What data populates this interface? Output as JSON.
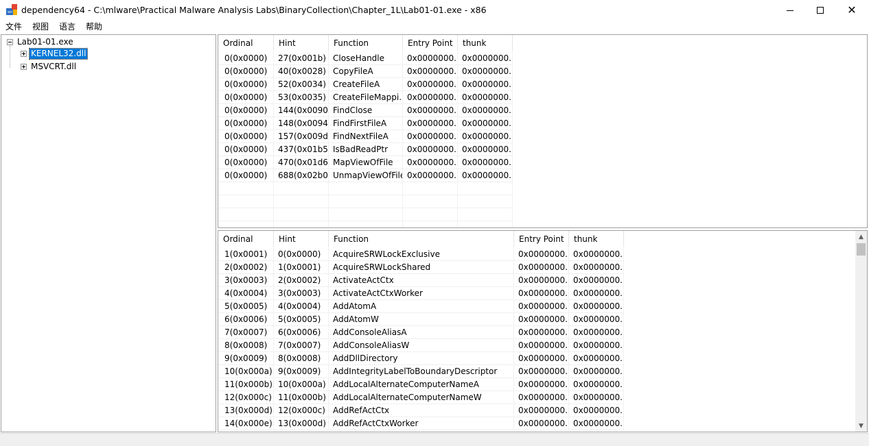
{
  "window": {
    "title": "dependency64 - C:\\mlware\\Practical Malware Analysis Labs\\BinaryCollection\\Chapter_1L\\Lab01-01.exe - x86",
    "icon_text": "wn",
    "minimize": "",
    "maximize": "",
    "close": "✕"
  },
  "menu": [
    "文件",
    "视图",
    "语言",
    "帮助"
  ],
  "tree": {
    "root": "Lab01-01.exe",
    "children": [
      "KERNEL32.dll",
      "MSVCRT.dll"
    ],
    "selected": "KERNEL32.dll"
  },
  "imports_table": {
    "columns": [
      "Ordinal",
      "Hint",
      "Function",
      "Entry Point",
      "thunk"
    ],
    "rows": [
      [
        "0(0x0000)",
        "27(0x001b)",
        "CloseHandle",
        "0x0000000...",
        "0x0000000..."
      ],
      [
        "0(0x0000)",
        "40(0x0028)",
        "CopyFileA",
        "0x0000000...",
        "0x0000000..."
      ],
      [
        "0(0x0000)",
        "52(0x0034)",
        "CreateFileA",
        "0x0000000...",
        "0x0000000..."
      ],
      [
        "0(0x0000)",
        "53(0x0035)",
        "CreateFileMappi...",
        "0x0000000...",
        "0x0000000..."
      ],
      [
        "0(0x0000)",
        "144(0x0090)",
        "FindClose",
        "0x0000000...",
        "0x0000000..."
      ],
      [
        "0(0x0000)",
        "148(0x0094)",
        "FindFirstFileA",
        "0x0000000...",
        "0x0000000..."
      ],
      [
        "0(0x0000)",
        "157(0x009d)",
        "FindNextFileA",
        "0x0000000...",
        "0x0000000..."
      ],
      [
        "0(0x0000)",
        "437(0x01b5)",
        "IsBadReadPtr",
        "0x0000000...",
        "0x0000000..."
      ],
      [
        "0(0x0000)",
        "470(0x01d6)",
        "MapViewOfFile",
        "0x0000000...",
        "0x0000000..."
      ],
      [
        "0(0x0000)",
        "688(0x02b0)",
        "UnmapViewOfFile",
        "0x0000000...",
        "0x0000000..."
      ]
    ]
  },
  "exports_table": {
    "columns": [
      "Ordinal",
      "Hint",
      "Function",
      "Entry Point",
      "thunk"
    ],
    "rows": [
      [
        "1(0x0001)",
        "0(0x0000)",
        "AcquireSRWLockExclusive",
        "0x0000000...",
        "0x0000000..."
      ],
      [
        "2(0x0002)",
        "1(0x0001)",
        "AcquireSRWLockShared",
        "0x0000000...",
        "0x0000000..."
      ],
      [
        "3(0x0003)",
        "2(0x0002)",
        "ActivateActCtx",
        "0x0000000...",
        "0x0000000..."
      ],
      [
        "4(0x0004)",
        "3(0x0003)",
        "ActivateActCtxWorker",
        "0x0000000...",
        "0x0000000..."
      ],
      [
        "5(0x0005)",
        "4(0x0004)",
        "AddAtomA",
        "0x0000000...",
        "0x0000000..."
      ],
      [
        "6(0x0006)",
        "5(0x0005)",
        "AddAtomW",
        "0x0000000...",
        "0x0000000..."
      ],
      [
        "7(0x0007)",
        "6(0x0006)",
        "AddConsoleAliasA",
        "0x0000000...",
        "0x0000000..."
      ],
      [
        "8(0x0008)",
        "7(0x0007)",
        "AddConsoleAliasW",
        "0x0000000...",
        "0x0000000..."
      ],
      [
        "9(0x0009)",
        "8(0x0008)",
        "AddDllDirectory",
        "0x0000000...",
        "0x0000000..."
      ],
      [
        "10(0x000a)",
        "9(0x0009)",
        "AddIntegrityLabelToBoundaryDescriptor",
        "0x0000000...",
        "0x0000000..."
      ],
      [
        "11(0x000b)",
        "10(0x000a)",
        "AddLocalAlternateComputerNameA",
        "0x0000000...",
        "0x0000000..."
      ],
      [
        "12(0x000c)",
        "11(0x000b)",
        "AddLocalAlternateComputerNameW",
        "0x0000000...",
        "0x0000000..."
      ],
      [
        "13(0x000d)",
        "12(0x000c)",
        "AddRefActCtx",
        "0x0000000...",
        "0x0000000..."
      ],
      [
        "14(0x000e)",
        "13(0x000d)",
        "AddRefActCtxWorker",
        "0x0000000...",
        "0x0000000..."
      ]
    ]
  },
  "colors": {
    "selection": "#0078d7",
    "border": "#a0a0a0",
    "statusbar": "#f0f0f0"
  }
}
